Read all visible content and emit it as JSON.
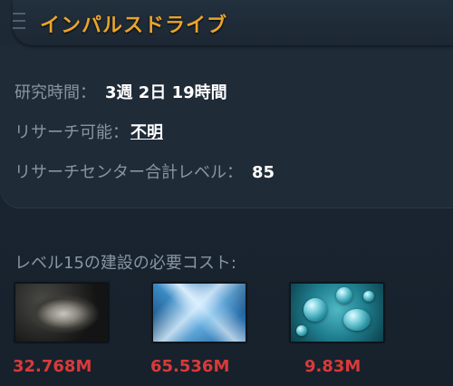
{
  "title": "インパルスドライブ",
  "info": {
    "research_time_label": "研究時間：",
    "research_time_value": "3週 2日 19時間",
    "researchable_label": "リサーチ可能：",
    "researchable_value": "不明",
    "research_center_label": "リサーチセンター合計レベル：",
    "research_center_value": "85"
  },
  "cost": {
    "label": "レベル15の建設の必要コスト:",
    "resources": [
      {
        "icon": "metal-icon",
        "value": "32.768M",
        "color": "#d93a3a"
      },
      {
        "icon": "crystal-icon",
        "value": "65.536M",
        "color": "#d93a3a"
      },
      {
        "icon": "deuterium-icon",
        "value": "9.83M",
        "color": "#d93a3a"
      }
    ]
  },
  "colors": {
    "title": "#e8a42c",
    "label": "#8796a4",
    "value": "#ffffff",
    "cost_insufficient": "#d93a3a",
    "background": "#1b2530"
  }
}
